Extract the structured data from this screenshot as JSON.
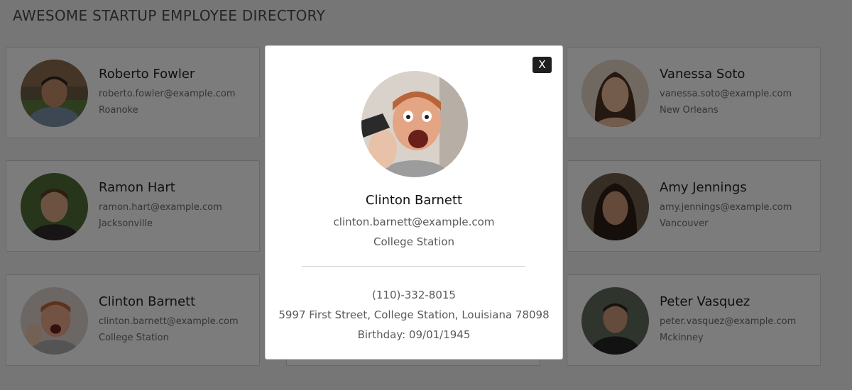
{
  "header": {
    "title": "AWESOME STARTUP EMPLOYEE DIRECTORY"
  },
  "employees": [
    {
      "name": "Roberto Fowler",
      "email": "roberto.fowler@example.com",
      "city": "Roanoke"
    },
    {
      "name": "Vanessa Soto",
      "email": "vanessa.soto@example.com",
      "city": "New Orleans"
    },
    {
      "name": "Ramon Hart",
      "email": "ramon.hart@example.com",
      "city": "Jacksonville"
    },
    {
      "name": "Amy Jennings",
      "email": "amy.jennings@example.com",
      "city": "Vancouver"
    },
    {
      "name": "Clinton Barnett",
      "email": "clinton.barnett@example.com",
      "city": "College Station"
    },
    {
      "name": "Peter Vasquez",
      "email": "peter.vasquez@example.com",
      "city": "Mckinney"
    }
  ],
  "modal": {
    "close_label": "X",
    "name": "Clinton Barnett",
    "email": "clinton.barnett@example.com",
    "city": "College Station",
    "phone": "(110)-332-8015",
    "address": "5997 First Street, College Station, Louisiana 78098",
    "birthday": "Birthday: 09/01/1945"
  },
  "colors": {
    "overlay": "#000000",
    "close_button": "#1f1f1f"
  }
}
